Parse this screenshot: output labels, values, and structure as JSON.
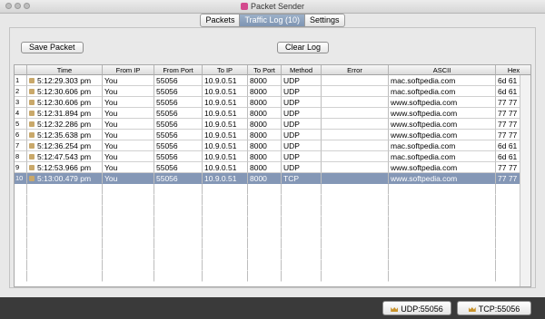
{
  "window": {
    "title": "Packet Sender"
  },
  "tabs": [
    {
      "label": "Packets",
      "active": false
    },
    {
      "label": "Traffic Log (10)",
      "active": true
    },
    {
      "label": "Settings",
      "active": false
    }
  ],
  "toolbar": {
    "save_packet_label": "Save Packet",
    "clear_log_label": "Clear Log"
  },
  "table": {
    "columns": [
      "",
      "Time",
      "From IP",
      "From Port",
      "To IP",
      "To Port",
      "Method",
      "Error",
      "ASCII",
      "Hex"
    ],
    "rows": [
      {
        "num": "1",
        "time": "5:12:29.303 pm",
        "from_ip": "You",
        "from_port": "55056",
        "to_ip": "10.9.0.51",
        "to_port": "8000",
        "method": "UDP",
        "error": "",
        "ascii": "mac.softpedia.com",
        "hex": "6d 61 63 ..."
      },
      {
        "num": "2",
        "time": "5:12:30.606 pm",
        "from_ip": "You",
        "from_port": "55056",
        "to_ip": "10.9.0.51",
        "to_port": "8000",
        "method": "UDP",
        "error": "",
        "ascii": "mac.softpedia.com",
        "hex": "6d 61 63 ..."
      },
      {
        "num": "3",
        "time": "5:12:30.606 pm",
        "from_ip": "You",
        "from_port": "55056",
        "to_ip": "10.9.0.51",
        "to_port": "8000",
        "method": "UDP",
        "error": "",
        "ascii": "www.softpedia.com",
        "hex": "77 77 77 ..."
      },
      {
        "num": "4",
        "time": "5:12:31.894 pm",
        "from_ip": "You",
        "from_port": "55056",
        "to_ip": "10.9.0.51",
        "to_port": "8000",
        "method": "UDP",
        "error": "",
        "ascii": "www.softpedia.com",
        "hex": "77 77 77 ..."
      },
      {
        "num": "5",
        "time": "5:12:32.286 pm",
        "from_ip": "You",
        "from_port": "55056",
        "to_ip": "10.9.0.51",
        "to_port": "8000",
        "method": "UDP",
        "error": "",
        "ascii": "www.softpedia.com",
        "hex": "77 77 77 ..."
      },
      {
        "num": "6",
        "time": "5:12:35.638 pm",
        "from_ip": "You",
        "from_port": "55056",
        "to_ip": "10.9.0.51",
        "to_port": "8000",
        "method": "UDP",
        "error": "",
        "ascii": "www.softpedia.com",
        "hex": "77 77 77 ..."
      },
      {
        "num": "7",
        "time": "5:12:36.254 pm",
        "from_ip": "You",
        "from_port": "55056",
        "to_ip": "10.9.0.51",
        "to_port": "8000",
        "method": "UDP",
        "error": "",
        "ascii": "mac.softpedia.com",
        "hex": "6d 61 63 ..."
      },
      {
        "num": "8",
        "time": "5:12:47.543 pm",
        "from_ip": "You",
        "from_port": "55056",
        "to_ip": "10.9.0.51",
        "to_port": "8000",
        "method": "UDP",
        "error": "",
        "ascii": "mac.softpedia.com",
        "hex": "6d 61 63 ..."
      },
      {
        "num": "9",
        "time": "5:12:53.966 pm",
        "from_ip": "You",
        "from_port": "55056",
        "to_ip": "10.9.0.51",
        "to_port": "8000",
        "method": "UDP",
        "error": "",
        "ascii": "www.softpedia.com",
        "hex": "77 77 77 ..."
      },
      {
        "num": "10",
        "time": "5:13:00.479 pm",
        "from_ip": "You",
        "from_port": "55056",
        "to_ip": "10.9.0.51",
        "to_port": "8000",
        "method": "TCP",
        "error": "",
        "ascii": "www.softpedia.com",
        "hex": "77 77 77 ...",
        "selected": true
      }
    ]
  },
  "status": {
    "udp_label": "UDP:55056",
    "tcp_label": "TCP:55056"
  },
  "colors": {
    "selected_row": "#8497b6",
    "active_tab": "#8a9fbc",
    "status_bar": "#3a3a3a"
  }
}
